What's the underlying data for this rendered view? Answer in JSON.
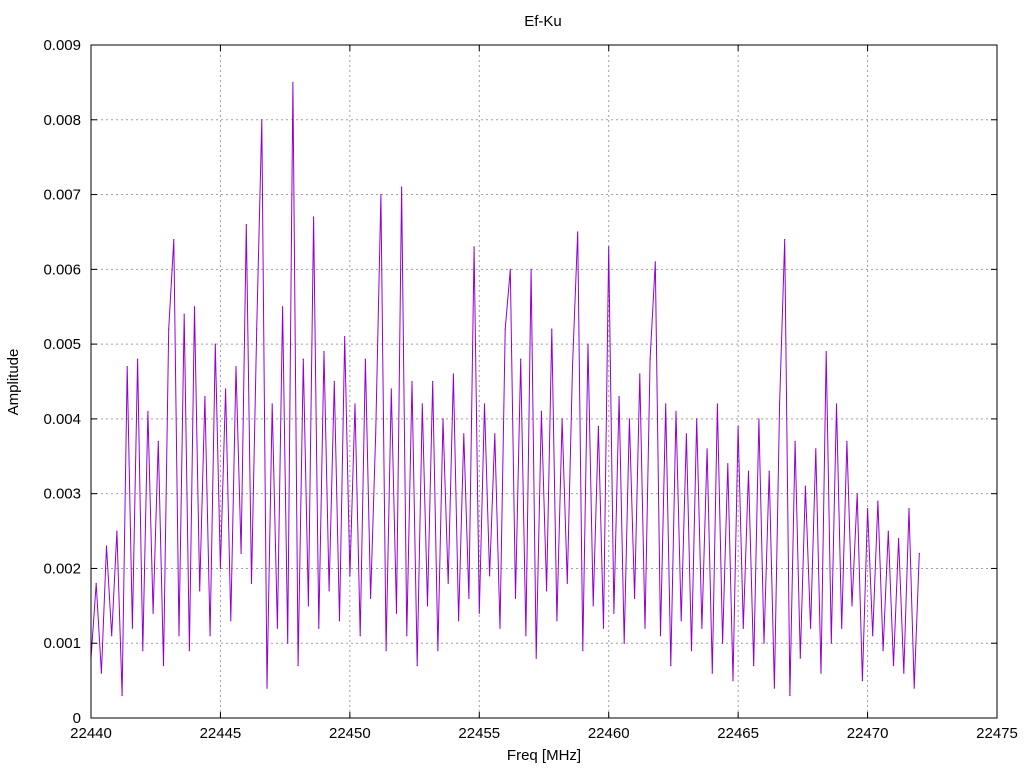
{
  "chart_data": {
    "type": "line",
    "title": "Ef-Ku",
    "xlabel": "Freq [MHz]",
    "ylabel": "Amplitude",
    "xlim": [
      22440,
      22475
    ],
    "ylim": [
      0,
      0.009
    ],
    "grid": true,
    "series_color": "#9400d3",
    "xticks": [
      "22440",
      "22445",
      "22450",
      "22455",
      "22460",
      "22465",
      "22470",
      "22475"
    ],
    "yticks": [
      "0",
      "0.001",
      "0.002",
      "0.003",
      "0.004",
      "0.005",
      "0.006",
      "0.007",
      "0.008",
      "0.009"
    ],
    "series": [
      {
        "name": "Ef-Ku",
        "x_start": 22440,
        "x_step": 0.2,
        "values": [
          0.0008,
          0.0018,
          0.0006,
          0.0023,
          0.0011,
          0.0025,
          0.0003,
          0.0047,
          0.0012,
          0.0048,
          0.0009,
          0.0041,
          0.0014,
          0.0037,
          0.0007,
          0.0052,
          0.0064,
          0.0011,
          0.0054,
          0.0009,
          0.0055,
          0.0017,
          0.0043,
          0.0011,
          0.005,
          0.002,
          0.0044,
          0.0013,
          0.0047,
          0.0022,
          0.0066,
          0.0018,
          0.0052,
          0.008,
          0.0004,
          0.0042,
          0.0012,
          0.0055,
          0.001,
          0.0085,
          0.0007,
          0.0048,
          0.0015,
          0.0067,
          0.0012,
          0.0049,
          0.0017,
          0.0045,
          0.0013,
          0.0051,
          0.0019,
          0.0042,
          0.0011,
          0.0048,
          0.0016,
          0.0038,
          0.007,
          0.0009,
          0.0044,
          0.0014,
          0.0071,
          0.0011,
          0.0045,
          0.0007,
          0.0042,
          0.0015,
          0.0045,
          0.0009,
          0.004,
          0.0018,
          0.0046,
          0.0013,
          0.0038,
          0.0016,
          0.0063,
          0.0014,
          0.0042,
          0.0019,
          0.0038,
          0.0012,
          0.0052,
          0.006,
          0.0016,
          0.0048,
          0.0011,
          0.006,
          0.0008,
          0.0041,
          0.0017,
          0.0052,
          0.0013,
          0.004,
          0.0018,
          0.0047,
          0.0065,
          0.0009,
          0.005,
          0.0015,
          0.0039,
          0.0012,
          0.0063,
          0.0014,
          0.0043,
          0.001,
          0.004,
          0.0016,
          0.0046,
          0.0012,
          0.0048,
          0.0061,
          0.0011,
          0.0042,
          0.0007,
          0.0041,
          0.0013,
          0.0038,
          0.0009,
          0.004,
          0.0012,
          0.0036,
          0.0006,
          0.0042,
          0.001,
          0.0034,
          0.0005,
          0.0039,
          0.0012,
          0.0033,
          0.0007,
          0.004,
          0.001,
          0.0033,
          0.0004,
          0.0042,
          0.0064,
          0.0003,
          0.0037,
          0.0008,
          0.0031,
          0.0012,
          0.0036,
          0.0006,
          0.0049,
          0.001,
          0.0042,
          0.0012,
          0.0037,
          0.0015,
          0.003,
          0.0005,
          0.0028,
          0.0011,
          0.0029,
          0.0009,
          0.0025,
          0.0007,
          0.0024,
          0.0006,
          0.0028,
          0.0004,
          0.0022
        ]
      }
    ]
  }
}
